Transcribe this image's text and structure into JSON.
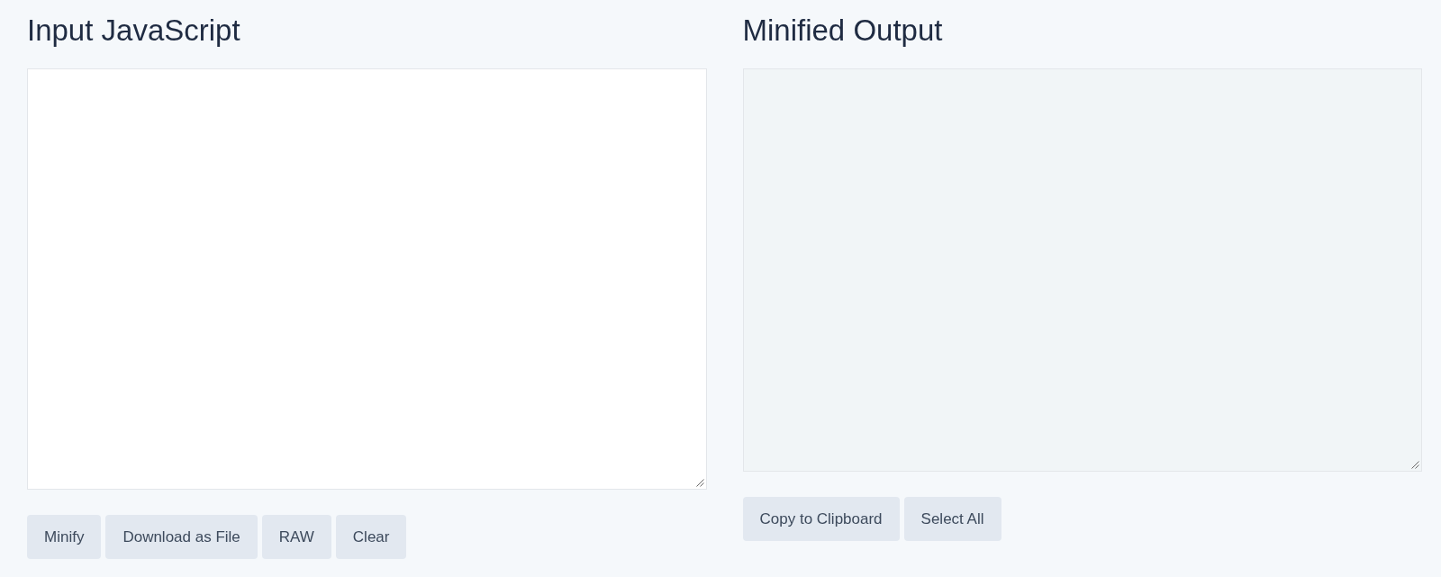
{
  "panels": [
    {
      "title": "Input JavaScript",
      "editor": {
        "readonly": false
      },
      "buttons": [
        "Minify",
        "Download as File",
        "RAW",
        "Clear"
      ]
    },
    {
      "title": "Minified Output",
      "editor": {
        "readonly": true
      },
      "buttons": [
        "Copy to Clipboard",
        "Select All"
      ]
    }
  ]
}
